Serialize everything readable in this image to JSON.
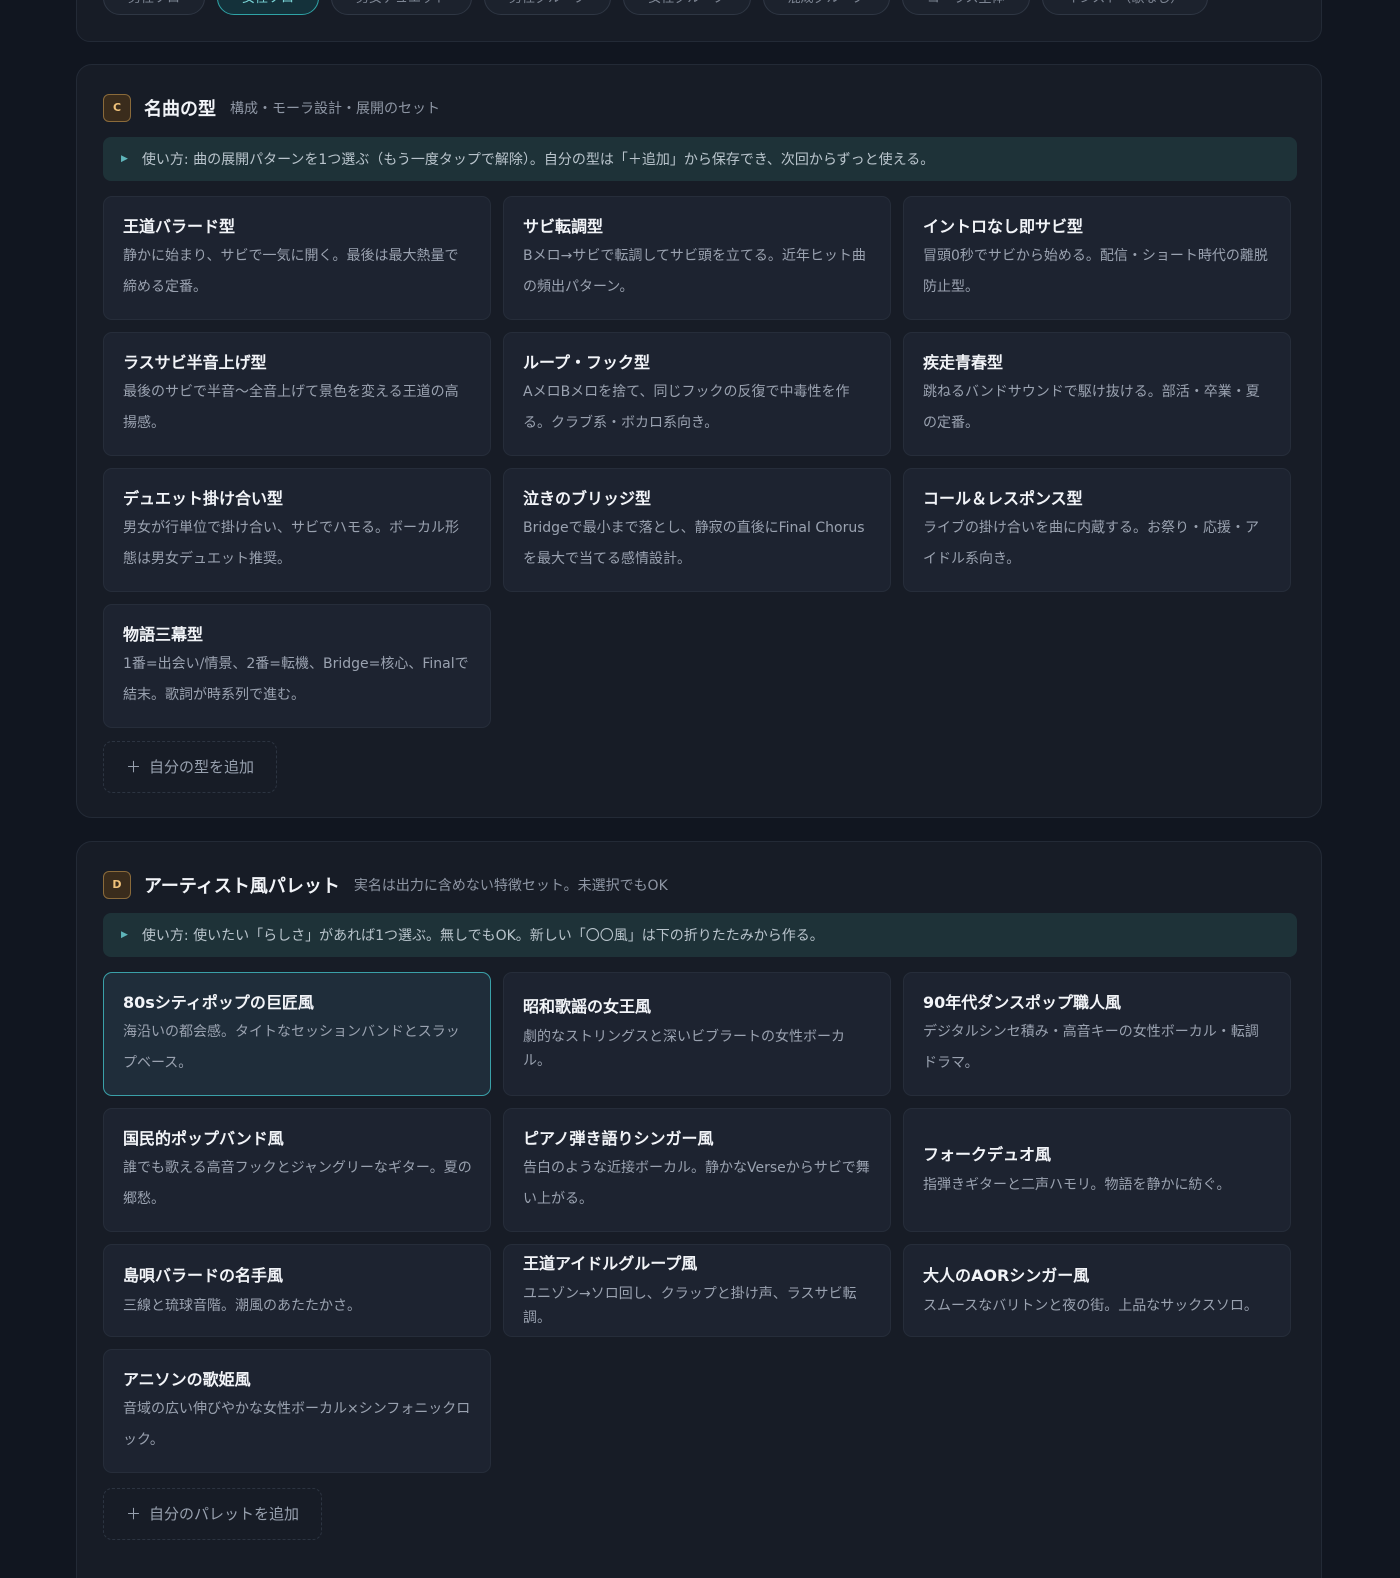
{
  "top_chips": [
    {
      "label": "男性ソロ",
      "active": false
    },
    {
      "label": "女性ソロ",
      "active": true
    },
    {
      "label": "男女デュエット",
      "active": false
    },
    {
      "label": "男性グループ",
      "active": false
    },
    {
      "label": "女性グループ",
      "active": false
    },
    {
      "label": "混成グループ",
      "active": false
    },
    {
      "label": "コーラス主体",
      "active": false
    },
    {
      "label": "インスト（歌なし）",
      "active": false
    }
  ],
  "section_c": {
    "badge": "C",
    "title": "名曲の型",
    "subtitle": "構成・モーラ設計・展開のセット",
    "hint": "使い方: 曲の展開パターンを1つ選ぶ（もう一度タップで解除）。自分の型は「＋追加」から保存でき、次回からずっと使える。",
    "cards": [
      {
        "title": "王道バラード型",
        "desc": "静かに始まり、サビで一気に開く。最後は最大熱量で締める定番。"
      },
      {
        "title": "サビ転調型",
        "desc": "Bメロ→サビで転調してサビ頭を立てる。近年ヒット曲の頻出パターン。"
      },
      {
        "title": "イントロなし即サビ型",
        "desc": "冒頭0秒でサビから始める。配信・ショート時代の離脱防止型。"
      },
      {
        "title": "ラスサビ半音上げ型",
        "desc": "最後のサビで半音〜全音上げて景色を変える王道の高揚感。"
      },
      {
        "title": "ループ・フック型",
        "desc": "AメロBメロを捨て、同じフックの反復で中毒性を作る。クラブ系・ボカロ系向き。"
      },
      {
        "title": "疾走青春型",
        "desc": "跳ねるバンドサウンドで駆け抜ける。部活・卒業・夏の定番。"
      },
      {
        "title": "デュエット掛け合い型",
        "desc": "男女が行単位で掛け合い、サビでハモる。ボーカル形態は男女デュエット推奨。"
      },
      {
        "title": "泣きのブリッジ型",
        "desc": "Bridgeで最小まで落とし、静寂の直後にFinal Chorusを最大で当てる感情設計。"
      },
      {
        "title": "コール＆レスポンス型",
        "desc": "ライブの掛け合いを曲に内蔵する。お祭り・応援・アイドル系向き。"
      },
      {
        "title": "物語三幕型",
        "desc": "1番=出会い/情景、2番=転機、Bridge=核心、Finalで結末。歌詞が時系列で進む。"
      }
    ],
    "add_label": "自分の型を追加"
  },
  "section_d": {
    "badge": "D",
    "title": "アーティスト風パレット",
    "subtitle": "実名は出力に含めない特徴セット。未選択でもOK",
    "hint": "使い方: 使いたい「らしさ」があれば1つ選ぶ。無しでもOK。新しい「〇〇風」は下の折りたたみから作る。",
    "cards": [
      {
        "title": "80sシティポップの巨匠風",
        "desc": "海沿いの都会感。タイトなセッションバンドとスラップベース。",
        "selected": true
      },
      {
        "title": "昭和歌謡の女王風",
        "desc": "劇的なストリングスと深いビブラートの女性ボーカル。"
      },
      {
        "title": "90年代ダンスポップ職人風",
        "desc": "デジタルシンセ積み・高音キーの女性ボーカル・転調ドラマ。"
      },
      {
        "title": "国民的ポップバンド風",
        "desc": "誰でも歌える高音フックとジャングリーなギター。夏の郷愁。"
      },
      {
        "title": "ピアノ弾き語りシンガー風",
        "desc": "告白のような近接ボーカル。静かなVerseからサビで舞い上がる。"
      },
      {
        "title": "フォークデュオ風",
        "desc": "指弾きギターと二声ハモリ。物語を静かに紡ぐ。"
      },
      {
        "title": "島唄バラードの名手風",
        "desc": "三線と琉球音階。潮風のあたたかさ。"
      },
      {
        "title": "王道アイドルグループ風",
        "desc": "ユニゾン→ソロ回し、クラップと掛け声、ラスサビ転調。"
      },
      {
        "title": "大人のAORシンガー風",
        "desc": "スムースなバリトンと夜の街。上品なサックスソロ。"
      },
      {
        "title": "アニソンの歌姫風",
        "desc": "音域の広い伸びやかな女性ボーカル×シンフォニックロック。"
      }
    ],
    "add_label": "自分のパレットを追加"
  },
  "icons": {
    "add": "plus-icon",
    "hint": "triangle-right-icon"
  },
  "colors": {
    "accent": "#2fa3a6",
    "badge": "#f0c27a",
    "background": "#111620"
  }
}
